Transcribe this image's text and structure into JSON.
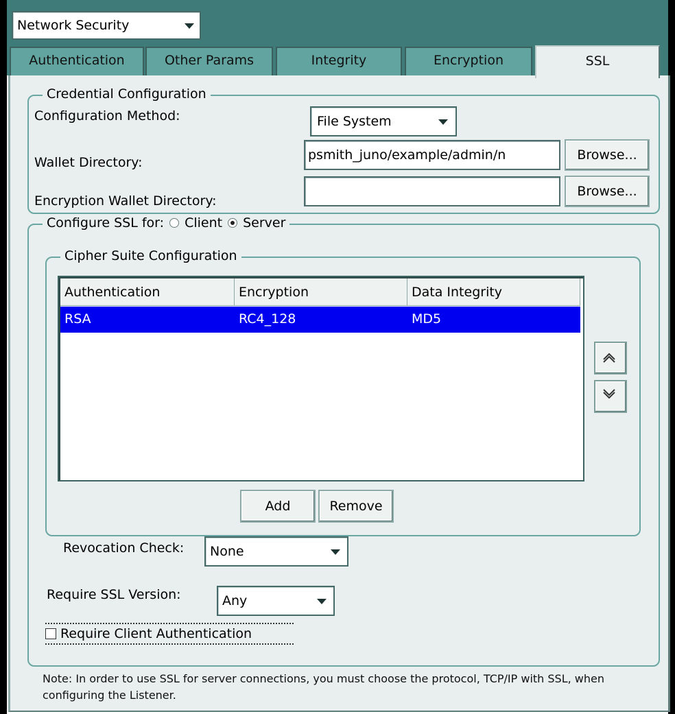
{
  "top_select": {
    "value": "Network Security"
  },
  "tabs": [
    {
      "label": "Authentication"
    },
    {
      "label": "Other Params"
    },
    {
      "label": "Integrity"
    },
    {
      "label": "Encryption"
    },
    {
      "label": "SSL"
    }
  ],
  "active_tab": "SSL",
  "credential": {
    "legend": "Credential Configuration",
    "method_label": "Configuration Method:",
    "method_value": "File System",
    "wallet_label": "Wallet Directory:",
    "wallet_value": "psmith_juno/example/admin/n",
    "enc_wallet_label": "Encryption Wallet Directory:",
    "enc_wallet_value": "",
    "browse_label": "Browse..."
  },
  "ssl_config": {
    "legend": "Configure SSL for:",
    "client_label": "Client",
    "server_label": "Server",
    "selected": "Server"
  },
  "cipher": {
    "legend": "Cipher Suite Configuration",
    "columns": [
      "Authentication",
      "Encryption",
      "Data Integrity"
    ],
    "rows": [
      {
        "auth": "RSA",
        "enc": "RC4_128",
        "integrity": "MD5",
        "selected": true
      }
    ],
    "add_label": "Add",
    "remove_label": "Remove",
    "up_icon": "chevron-up-icon",
    "down_icon": "chevron-down-icon"
  },
  "revocation": {
    "label": "Revocation Check:",
    "value": "None"
  },
  "ssl_version": {
    "label": "Require SSL Version:",
    "value": "Any"
  },
  "client_auth": {
    "label": "Require Client Authentication",
    "checked": false
  },
  "note": "Note: In order to use SSL for server connections, you must choose the protocol, TCP/IP with SSL, when configuring the Listener.",
  "colors": {
    "teal": "#3f7b78",
    "tab": "#62a4a0",
    "panel": "#e8efee",
    "group_border": "#6aa6a2",
    "selection": "#0000f0"
  }
}
